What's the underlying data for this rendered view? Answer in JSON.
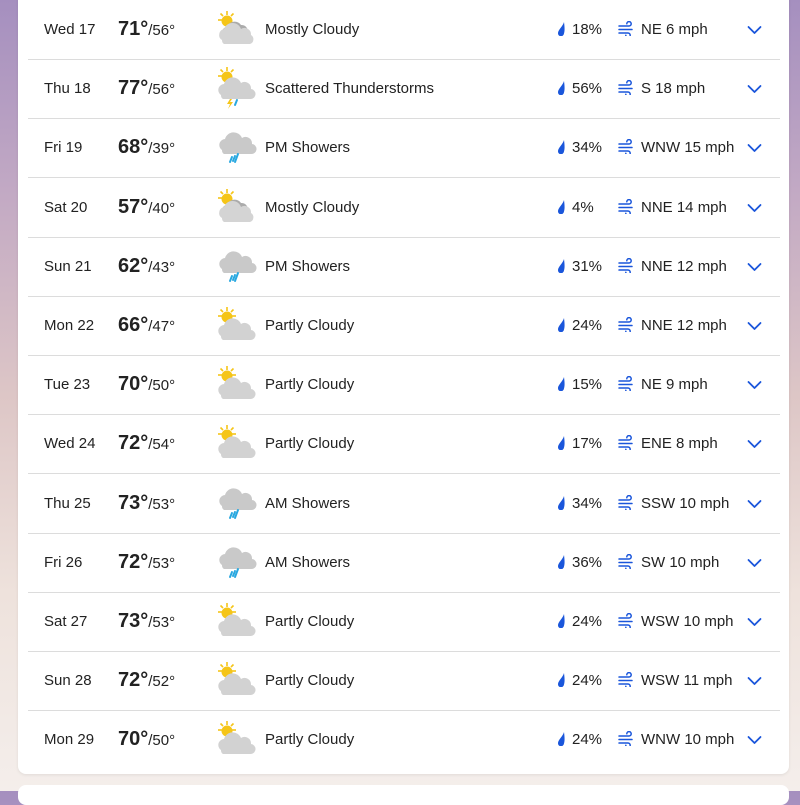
{
  "forecast": [
    {
      "day": "Wed 17",
      "high": "71°",
      "low": "56°",
      "icon": "mostly-cloudy-icon",
      "condition": "Mostly Cloudy",
      "precip": "18%",
      "wind": "NE 6 mph"
    },
    {
      "day": "Thu 18",
      "high": "77°",
      "low": "56°",
      "icon": "thunderstorm-icon",
      "condition": "Scattered Thunderstorms",
      "precip": "56%",
      "wind": "S 18 mph"
    },
    {
      "day": "Fri 19",
      "high": "68°",
      "low": "39°",
      "icon": "showers-icon",
      "condition": "PM Showers",
      "precip": "34%",
      "wind": "WNW 15 mph"
    },
    {
      "day": "Sat 20",
      "high": "57°",
      "low": "40°",
      "icon": "mostly-cloudy-icon",
      "condition": "Mostly Cloudy",
      "precip": "4%",
      "wind": "NNE 14 mph"
    },
    {
      "day": "Sun 21",
      "high": "62°",
      "low": "43°",
      "icon": "showers-icon",
      "condition": "PM Showers",
      "precip": "31%",
      "wind": "NNE 12 mph"
    },
    {
      "day": "Mon 22",
      "high": "66°",
      "low": "47°",
      "icon": "partly-cloudy-icon",
      "condition": "Partly Cloudy",
      "precip": "24%",
      "wind": "NNE 12 mph"
    },
    {
      "day": "Tue 23",
      "high": "70°",
      "low": "50°",
      "icon": "partly-cloudy-icon",
      "condition": "Partly Cloudy",
      "precip": "15%",
      "wind": "NE 9 mph"
    },
    {
      "day": "Wed 24",
      "high": "72°",
      "low": "54°",
      "icon": "partly-cloudy-icon",
      "condition": "Partly Cloudy",
      "precip": "17%",
      "wind": "ENE 8 mph"
    },
    {
      "day": "Thu 25",
      "high": "73°",
      "low": "53°",
      "icon": "showers-icon",
      "condition": "AM Showers",
      "precip": "34%",
      "wind": "SSW 10 mph"
    },
    {
      "day": "Fri 26",
      "high": "72°",
      "low": "53°",
      "icon": "showers-icon",
      "condition": "AM Showers",
      "precip": "36%",
      "wind": "SW 10 mph"
    },
    {
      "day": "Sat 27",
      "high": "73°",
      "low": "53°",
      "icon": "partly-cloudy-icon",
      "condition": "Partly Cloudy",
      "precip": "24%",
      "wind": "WSW 10 mph"
    },
    {
      "day": "Sun 28",
      "high": "72°",
      "low": "52°",
      "icon": "partly-cloudy-icon",
      "condition": "Partly Cloudy",
      "precip": "24%",
      "wind": "WSW 11 mph"
    },
    {
      "day": "Mon 29",
      "high": "70°",
      "low": "50°",
      "icon": "partly-cloudy-icon",
      "condition": "Partly Cloudy",
      "precip": "24%",
      "wind": "WNW 10 mph"
    }
  ],
  "colors": {
    "accent": "#1a56db",
    "sun": "#f5c518",
    "cloud": "#c8c8c8",
    "rain": "#29a8e0"
  }
}
